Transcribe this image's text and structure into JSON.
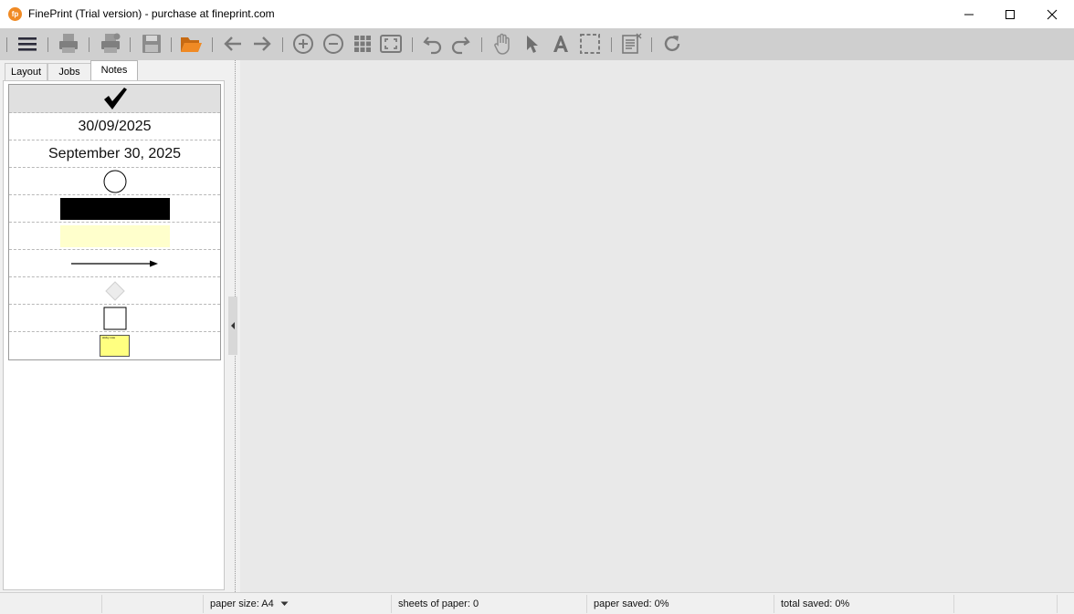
{
  "window": {
    "title": "FinePrint (Trial version) - purchase at fineprint.com",
    "app_icon_text": "fp"
  },
  "toolbar": {
    "buttons": [
      "menu-icon",
      "print-icon",
      "print-settings-icon",
      "save-icon",
      "open-folder-icon",
      "back-arrow-icon",
      "forward-arrow-icon",
      "zoom-in-icon",
      "zoom-out-icon",
      "thumbnails-grid-icon",
      "fit-page-icon",
      "undo-icon",
      "redo-icon",
      "hand-tool-icon",
      "pointer-tool-icon",
      "text-tool-icon",
      "select-area-icon",
      "notes-edit-icon",
      "refresh-icon"
    ]
  },
  "tabs": [
    {
      "label": "Layout"
    },
    {
      "label": "Jobs"
    },
    {
      "label": "Notes",
      "active": true
    }
  ],
  "notes": {
    "date_numeric": "30/09/2025",
    "date_long": "September 30, 2025",
    "sticky_note_text": "sticky note",
    "highlight_color": "#ffffcc",
    "sticky_color": "#ffff80"
  },
  "status": {
    "paper_size_label": "paper size: A4",
    "sheets_label": "sheets of paper: 0",
    "paper_saved_label": "paper saved: 0%",
    "total_saved_label": "total saved: 0%"
  },
  "colors": {
    "accent_orange": "#f08a24",
    "toolbar_bg": "#cfcfcf",
    "workspace_bg": "#e9e9e9"
  }
}
